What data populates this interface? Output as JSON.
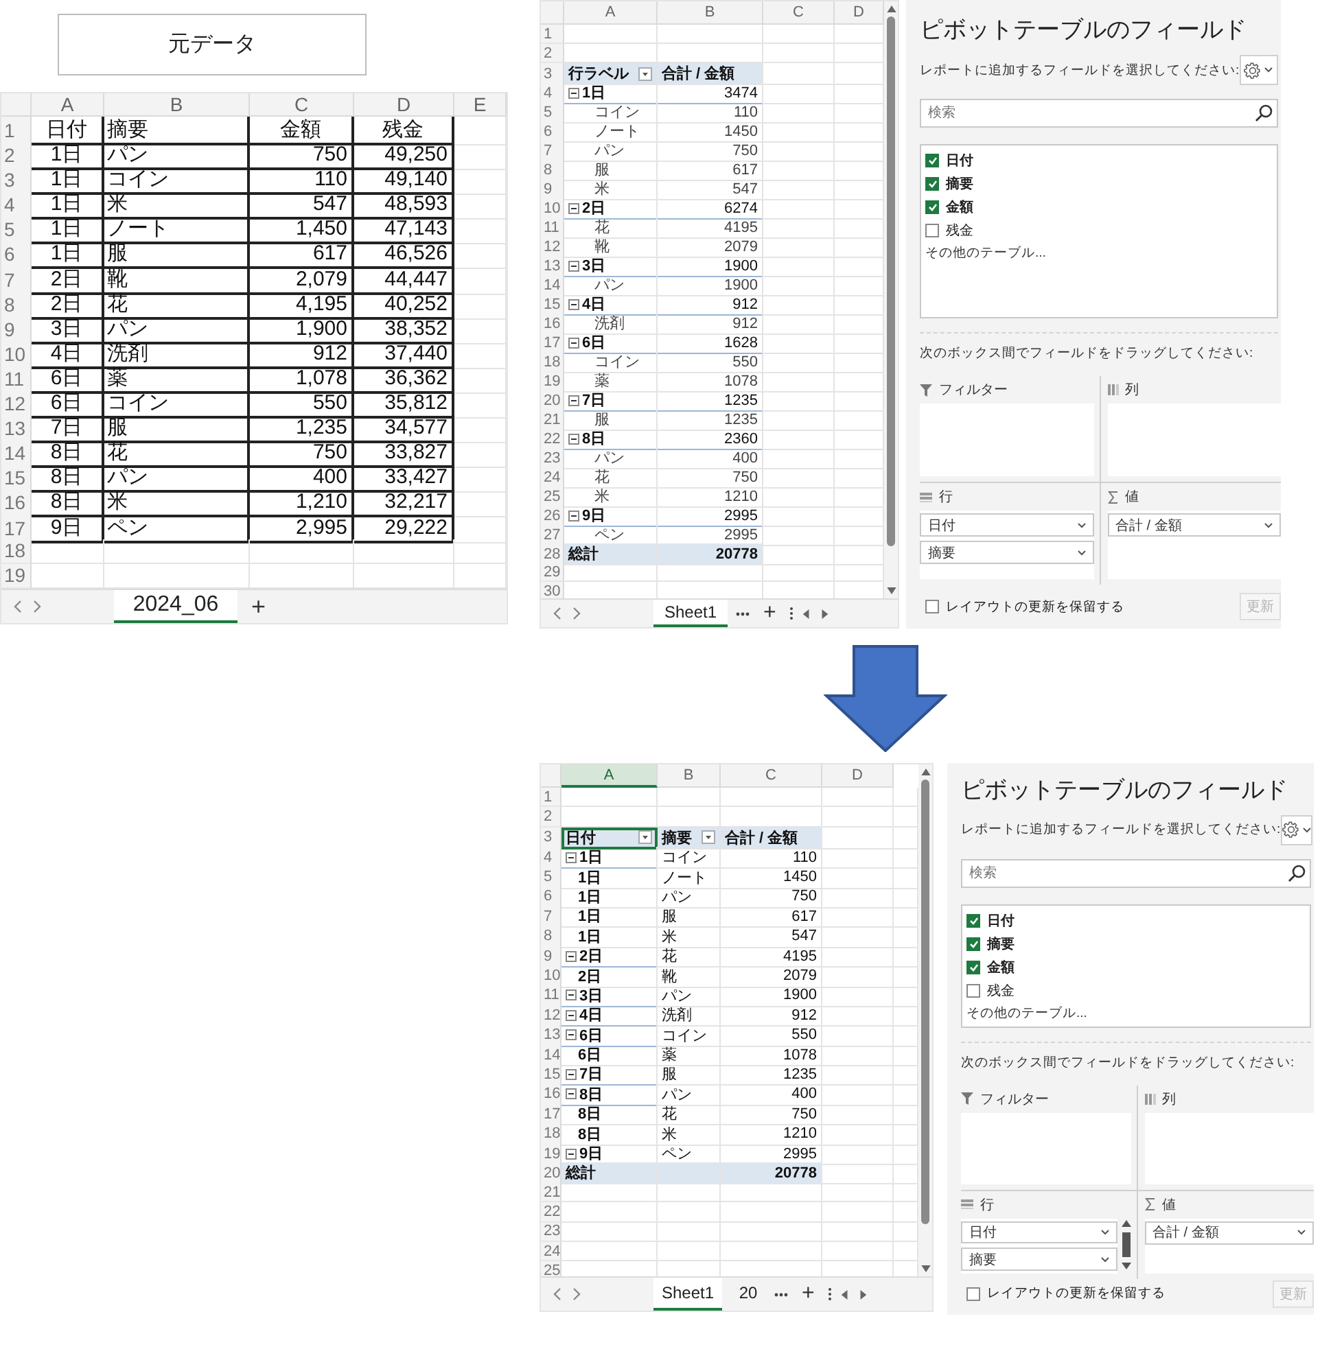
{
  "source_button": "元データ",
  "source_sheet": {
    "column_headers": [
      {
        "label": "A",
        "selected": false
      },
      {
        "label": "B",
        "selected": false
      },
      {
        "label": "C",
        "selected": false
      },
      {
        "label": "D",
        "selected": false
      },
      {
        "label": "E",
        "selected": false
      }
    ],
    "rows": [
      {
        "number": "1",
        "kind": "header",
        "cells": [
          "日付",
          "摘要",
          "金額",
          "残金"
        ]
      },
      {
        "number": "2",
        "kind": "data",
        "cells": [
          "1日",
          "パン",
          "750",
          "49,250"
        ]
      },
      {
        "number": "3",
        "kind": "data",
        "cells": [
          "1日",
          "コイン",
          "110",
          "49,140"
        ]
      },
      {
        "number": "4",
        "kind": "data",
        "cells": [
          "1日",
          "米",
          "547",
          "48,593"
        ]
      },
      {
        "number": "5",
        "kind": "data",
        "cells": [
          "1日",
          "ノート",
          "1,450",
          "47,143"
        ]
      },
      {
        "number": "6",
        "kind": "data",
        "cells": [
          "1日",
          "服",
          "617",
          "46,526"
        ]
      },
      {
        "number": "7",
        "kind": "data",
        "cells": [
          "2日",
          "靴",
          "2,079",
          "44,447"
        ]
      },
      {
        "number": "8",
        "kind": "data",
        "cells": [
          "2日",
          "花",
          "4,195",
          "40,252"
        ]
      },
      {
        "number": "9",
        "kind": "data",
        "cells": [
          "3日",
          "パン",
          "1,900",
          "38,352"
        ]
      },
      {
        "number": "10",
        "kind": "data",
        "cells": [
          "4日",
          "洗剤",
          "912",
          "37,440"
        ]
      },
      {
        "number": "11",
        "kind": "data",
        "cells": [
          "6日",
          "薬",
          "1,078",
          "36,362"
        ]
      },
      {
        "number": "12",
        "kind": "data",
        "cells": [
          "6日",
          "コイン",
          "550",
          "35,812"
        ]
      },
      {
        "number": "13",
        "kind": "data",
        "cells": [
          "7日",
          "服",
          "1,235",
          "34,577"
        ]
      },
      {
        "number": "14",
        "kind": "data",
        "cells": [
          "8日",
          "花",
          "750",
          "33,827"
        ]
      },
      {
        "number": "15",
        "kind": "data",
        "cells": [
          "8日",
          "パン",
          "400",
          "33,427"
        ]
      },
      {
        "number": "16",
        "kind": "data",
        "cells": [
          "8日",
          "米",
          "1,210",
          "32,217"
        ]
      },
      {
        "number": "17",
        "kind": "data",
        "cells": [
          "9日",
          "ペン",
          "2,995",
          "29,222"
        ]
      },
      {
        "number": "18",
        "kind": "empty"
      },
      {
        "number": "19",
        "kind": "empty"
      }
    ],
    "tabs": [
      {
        "label": "2024_06",
        "selected": true
      }
    ],
    "add_tab": "+"
  },
  "pivot_before": {
    "grid": {
      "column_headers": [
        {
          "label": "A",
          "selected": false
        },
        {
          "label": "B",
          "selected": false
        },
        {
          "label": "C",
          "selected": false
        },
        {
          "label": "D",
          "selected": false
        }
      ],
      "rows": [
        {
          "number": "1",
          "kind": "empty"
        },
        {
          "number": "2",
          "kind": "empty"
        },
        {
          "number": "3",
          "kind": "header",
          "cells": [
            "行ラベル",
            "合計 / 金額"
          ]
        },
        {
          "number": "4",
          "kind": "group",
          "cells": [
            "1日",
            "3474"
          ]
        },
        {
          "number": "5",
          "kind": "item",
          "cells": [
            "コイン",
            "110"
          ]
        },
        {
          "number": "6",
          "kind": "item",
          "cells": [
            "ノート",
            "1450"
          ]
        },
        {
          "number": "7",
          "kind": "item",
          "cells": [
            "パン",
            "750"
          ]
        },
        {
          "number": "8",
          "kind": "item",
          "cells": [
            "服",
            "617"
          ]
        },
        {
          "number": "9",
          "kind": "item",
          "cells": [
            "米",
            "547"
          ]
        },
        {
          "number": "10",
          "kind": "group",
          "cells": [
            "2日",
            "6274"
          ]
        },
        {
          "number": "11",
          "kind": "item",
          "cells": [
            "花",
            "4195"
          ]
        },
        {
          "number": "12",
          "kind": "item",
          "cells": [
            "靴",
            "2079"
          ]
        },
        {
          "number": "13",
          "kind": "group",
          "cells": [
            "3日",
            "1900"
          ]
        },
        {
          "number": "14",
          "kind": "item",
          "cells": [
            "パン",
            "1900"
          ]
        },
        {
          "number": "15",
          "kind": "group",
          "cells": [
            "4日",
            "912"
          ]
        },
        {
          "number": "16",
          "kind": "item",
          "cells": [
            "洗剤",
            "912"
          ]
        },
        {
          "number": "17",
          "kind": "group",
          "cells": [
            "6日",
            "1628"
          ]
        },
        {
          "number": "18",
          "kind": "item",
          "cells": [
            "コイン",
            "550"
          ]
        },
        {
          "number": "19",
          "kind": "item",
          "cells": [
            "薬",
            "1078"
          ]
        },
        {
          "number": "20",
          "kind": "group",
          "cells": [
            "7日",
            "1235"
          ]
        },
        {
          "number": "21",
          "kind": "item",
          "cells": [
            "服",
            "1235"
          ]
        },
        {
          "number": "22",
          "kind": "group",
          "cells": [
            "8日",
            "2360"
          ]
        },
        {
          "number": "23",
          "kind": "item",
          "cells": [
            "パン",
            "400"
          ]
        },
        {
          "number": "24",
          "kind": "item",
          "cells": [
            "花",
            "750"
          ]
        },
        {
          "number": "25",
          "kind": "item",
          "cells": [
            "米",
            "1210"
          ]
        },
        {
          "number": "26",
          "kind": "group",
          "cells": [
            "9日",
            "2995"
          ]
        },
        {
          "number": "27",
          "kind": "item",
          "cells": [
            "ペン",
            "2995"
          ]
        },
        {
          "number": "28",
          "kind": "total",
          "cells": [
            "総計",
            "20778"
          ]
        },
        {
          "number": "29",
          "kind": "empty"
        },
        {
          "number": "30",
          "kind": "empty"
        }
      ],
      "tabs": [
        {
          "label": "Sheet1",
          "selected": true
        }
      ],
      "add_tab": "+"
    },
    "fields_panel": {
      "title": "ピボットテーブルのフィールド",
      "subtitle": "レポートに追加するフィールドを選択してください:",
      "search": {
        "placeholder": "検索"
      },
      "fields": [
        {
          "label": "日付",
          "checked": true
        },
        {
          "label": "摘要",
          "checked": true
        },
        {
          "label": "金額",
          "checked": true
        },
        {
          "label": "残金",
          "checked": false
        }
      ],
      "more_tables": "その他のテーブル...",
      "drag_hint": "次のボックス間でフィールドをドラッグしてください:",
      "areas": [
        {
          "kind": "filter",
          "label": "フィルター"
        },
        {
          "kind": "columns",
          "label": "列"
        },
        {
          "kind": "rows",
          "label": "行",
          "items": [
            "日付",
            "摘要"
          ]
        },
        {
          "kind": "values",
          "label": "値",
          "items": [
            "合計 / 金額"
          ]
        }
      ],
      "defer": {
        "label": "レイアウトの更新を保留する",
        "checked": false
      },
      "update": {
        "label": "更新",
        "disabled": true
      }
    }
  },
  "pivot_after": {
    "grid": {
      "column_headers": [
        {
          "label": "A",
          "selected": true
        },
        {
          "label": "B",
          "selected": false
        },
        {
          "label": "C",
          "selected": false
        },
        {
          "label": "D",
          "selected": false
        }
      ],
      "rows": [
        {
          "number": "1",
          "kind": "empty"
        },
        {
          "number": "2",
          "kind": "empty"
        },
        {
          "number": "3",
          "kind": "header",
          "cells": [
            "日付",
            "摘要",
            "合計 / 金額"
          ]
        },
        {
          "number": "4",
          "kind": "group",
          "cells": [
            "1日",
            "コイン",
            "110"
          ]
        },
        {
          "number": "5",
          "kind": "item",
          "cells": [
            "1日",
            "ノート",
            "1450"
          ]
        },
        {
          "number": "6",
          "kind": "item",
          "cells": [
            "1日",
            "パン",
            "750"
          ]
        },
        {
          "number": "7",
          "kind": "item",
          "cells": [
            "1日",
            "服",
            "617"
          ]
        },
        {
          "number": "8",
          "kind": "item",
          "cells": [
            "1日",
            "米",
            "547"
          ]
        },
        {
          "number": "9",
          "kind": "group",
          "cells": [
            "2日",
            "花",
            "4195"
          ]
        },
        {
          "number": "10",
          "kind": "item",
          "cells": [
            "2日",
            "靴",
            "2079"
          ]
        },
        {
          "number": "11",
          "kind": "group",
          "cells": [
            "3日",
            "パン",
            "1900"
          ]
        },
        {
          "number": "12",
          "kind": "group",
          "cells": [
            "4日",
            "洗剤",
            "912"
          ]
        },
        {
          "number": "13",
          "kind": "group",
          "cells": [
            "6日",
            "コイン",
            "550"
          ]
        },
        {
          "number": "14",
          "kind": "item",
          "cells": [
            "6日",
            "薬",
            "1078"
          ]
        },
        {
          "number": "15",
          "kind": "group",
          "cells": [
            "7日",
            "服",
            "1235"
          ]
        },
        {
          "number": "16",
          "kind": "group",
          "cells": [
            "8日",
            "パン",
            "400"
          ]
        },
        {
          "number": "17",
          "kind": "item",
          "cells": [
            "8日",
            "花",
            "750"
          ]
        },
        {
          "number": "18",
          "kind": "item",
          "cells": [
            "8日",
            "米",
            "1210"
          ]
        },
        {
          "number": "19",
          "kind": "group",
          "cells": [
            "9日",
            "ペン",
            "2995"
          ]
        },
        {
          "number": "20",
          "kind": "total",
          "cells": [
            "総計",
            "",
            "20778"
          ]
        },
        {
          "number": "21",
          "kind": "empty"
        },
        {
          "number": "22",
          "kind": "empty"
        },
        {
          "number": "23",
          "kind": "empty"
        },
        {
          "number": "24",
          "kind": "empty"
        },
        {
          "number": "25",
          "kind": "empty"
        }
      ],
      "tabs": [
        {
          "label": "Sheet1",
          "selected": true
        },
        {
          "label": "20",
          "selected": false
        }
      ],
      "add_tab": "+"
    },
    "fields_panel": {
      "title": "ピボットテーブルのフィールド",
      "subtitle": "レポートに追加するフィールドを選択してください:",
      "search": {
        "placeholder": "検索"
      },
      "fields": [
        {
          "label": "日付",
          "checked": true
        },
        {
          "label": "摘要",
          "checked": true
        },
        {
          "label": "金額",
          "checked": true
        },
        {
          "label": "残金",
          "checked": false
        }
      ],
      "more_tables": "その他のテーブル...",
      "drag_hint": "次のボックス間でフィールドをドラッグしてください:",
      "areas": [
        {
          "kind": "filter",
          "label": "フィルター"
        },
        {
          "kind": "columns",
          "label": "列"
        },
        {
          "kind": "rows",
          "label": "行",
          "items": [
            "日付",
            "摘要"
          ]
        },
        {
          "kind": "values",
          "label": "値",
          "items": [
            "合計 / 金額"
          ]
        }
      ],
      "defer": {
        "label": "レイアウトの更新を保留する",
        "checked": false
      },
      "update": {
        "label": "更新",
        "disabled": true
      }
    }
  }
}
